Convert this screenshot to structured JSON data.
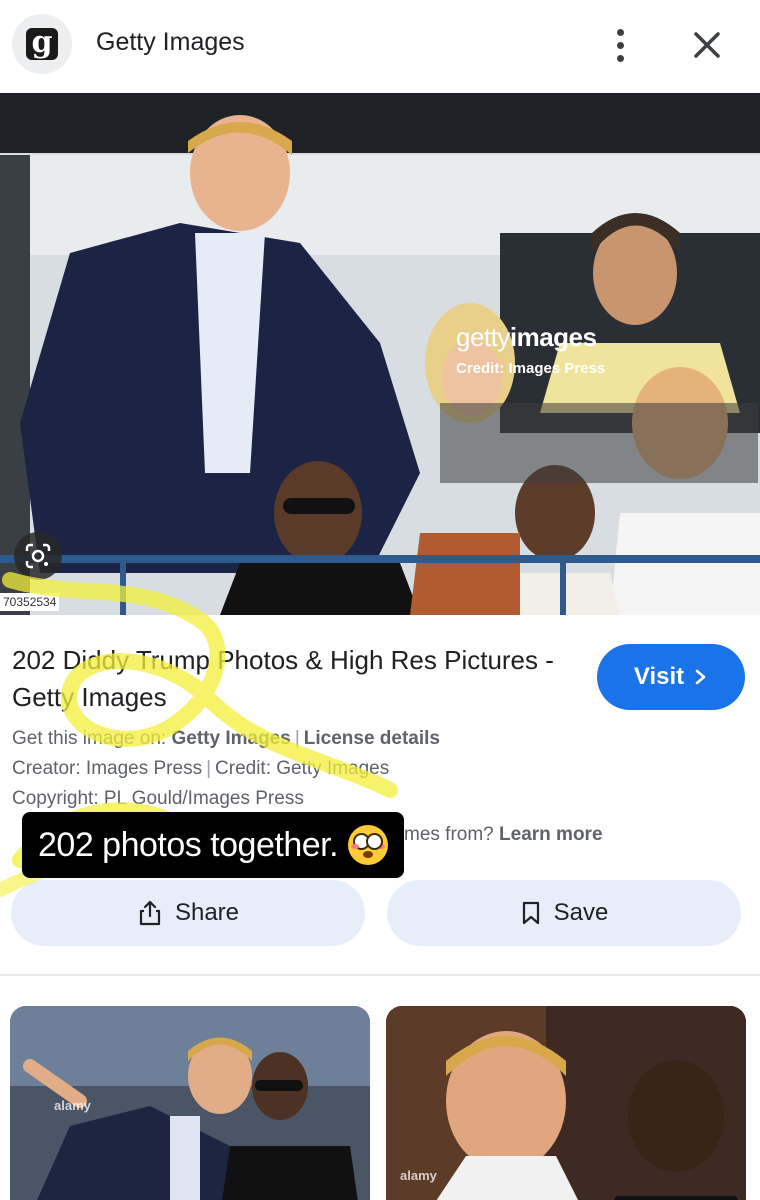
{
  "header": {
    "logo_letter": "g",
    "site_name": "Getty Images",
    "more_icon": "more-vert-icon",
    "close_icon": "close-icon"
  },
  "image": {
    "watermark_brand_light": "getty",
    "watermark_brand_bold": "images",
    "watermark_credit": "Credit: Images Press",
    "image_id": "70352534",
    "lens_icon": "lens-icon"
  },
  "result": {
    "title": "202 Diddy Trump Photos & High Res Pictures - Getty Images",
    "visit_label": "Visit",
    "get_image_prefix": "Get this image on:",
    "get_image_source": "Getty Images",
    "license_details": "License details",
    "creator": "Creator: Images Press",
    "credit": "Credit: Getty Images",
    "copyright": "Copyright: PL Gould/Images Press",
    "learn_prefix": "mes from?",
    "learn_more": "Learn more",
    "share_label": "Share",
    "save_label": "Save"
  },
  "story_overlay": {
    "sticker_text": "202 photos together.",
    "emoji": "flushed-face-emoji",
    "highlight_color": "#f3ef3a"
  },
  "related": {
    "thumb1_tag": "alamy",
    "thumb2_tag": "alamy"
  },
  "colors": {
    "accent": "#1a73e8",
    "pill_bg": "#e8eef9"
  }
}
